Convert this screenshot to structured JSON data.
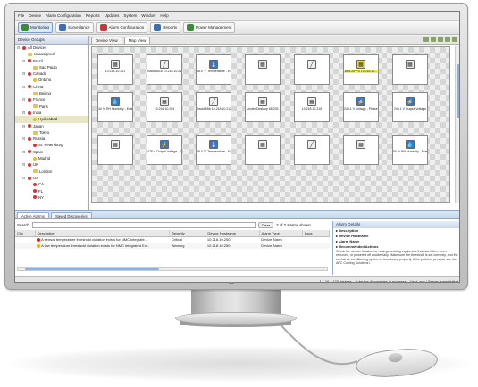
{
  "menubar": [
    "File",
    "Device",
    "Alarm Configuration",
    "Reports",
    "Updates",
    "System",
    "Window",
    "Help"
  ],
  "toolbar": [
    {
      "label": "Monitoring",
      "color": "#3b8a3b",
      "active": true
    },
    {
      "label": "Surveillance",
      "color": "#3b6fb6",
      "active": false
    },
    {
      "label": "Alarm Configuration",
      "color": "#c23b3b",
      "active": false
    },
    {
      "label": "Reports",
      "color": "#3b6fb6",
      "active": false
    },
    {
      "label": "Power Management",
      "color": "#3b8a3b",
      "active": false
    }
  ],
  "left_panel": {
    "title": "Device Groups"
  },
  "tree": [
    {
      "label": "All Devices",
      "level": 0,
      "dot": "r",
      "open": true
    },
    {
      "label": "Unassigned",
      "level": 1,
      "dot": "f"
    },
    {
      "label": "Brazil",
      "level": 1,
      "dot": "r",
      "open": true
    },
    {
      "label": "Sao Paulo",
      "level": 2,
      "dot": "f"
    },
    {
      "label": "Canada",
      "level": 1,
      "dot": "r",
      "open": true
    },
    {
      "label": "Ontario",
      "level": 2,
      "dot": "y"
    },
    {
      "label": "China",
      "level": 1,
      "dot": "r",
      "open": true
    },
    {
      "label": "Beijing",
      "level": 2,
      "dot": "f"
    },
    {
      "label": "France",
      "level": 1,
      "dot": "r",
      "open": true
    },
    {
      "label": "Paris",
      "level": 2,
      "dot": "f"
    },
    {
      "label": "India",
      "level": 1,
      "dot": "r",
      "open": true
    },
    {
      "label": "Hyderabad",
      "level": 2,
      "dot": "y",
      "selected": true
    },
    {
      "label": "Japan",
      "level": 1,
      "dot": "r",
      "open": true
    },
    {
      "label": "Tokyo",
      "level": 2,
      "dot": "f"
    },
    {
      "label": "Russia",
      "level": 1,
      "dot": "r",
      "open": true
    },
    {
      "label": "St. Petersburg",
      "level": 2,
      "dot": "r"
    },
    {
      "label": "Spain",
      "level": 1,
      "dot": "r",
      "open": true
    },
    {
      "label": "Madrid",
      "level": 2,
      "dot": "y"
    },
    {
      "label": "UK",
      "level": 1,
      "dot": "r",
      "open": true
    },
    {
      "label": "London",
      "level": 2,
      "dot": "f"
    },
    {
      "label": "US",
      "level": 1,
      "dot": "r",
      "open": true
    },
    {
      "label": "CA",
      "level": 2,
      "dot": "r"
    },
    {
      "label": "FL",
      "level": 2,
      "dot": "r"
    },
    {
      "label": "NY",
      "level": 2,
      "dot": "r"
    }
  ],
  "tabs": [
    {
      "label": "Device View",
      "active": false
    },
    {
      "label": "Map View",
      "active": true
    }
  ],
  "map_tiles": [
    {
      "caption": "10.218.10.201",
      "glyph": "▦",
      "tone": "grey"
    },
    {
      "caption": "Rack 8516 10.218.10.211",
      "glyph": "╱",
      "tone": "grey"
    },
    {
      "caption": "68.0 °F Temperature - Extern",
      "glyph": "🌡",
      "tone": "blue"
    },
    {
      "caption": "",
      "glyph": "▦",
      "tone": "grey"
    },
    {
      "caption": "",
      "glyph": "╱",
      "tone": "grey"
    },
    {
      "caption": "AP8-APPS 10.218.10...",
      "glyph": "▦",
      "tone": "yellow",
      "highlight": true
    },
    {
      "caption": "",
      "glyph": "▦",
      "tone": "grey"
    },
    {
      "caption": "40 % RH Humidity - External",
      "glyph": "💧",
      "tone": "blue"
    },
    {
      "caption": "10.216.10.204",
      "glyph": "▦",
      "tone": "grey"
    },
    {
      "caption": "Rack8656 10.218.10.212",
      "glyph": "╱",
      "tone": "grey"
    },
    {
      "caption": "Under Desktop 68.033",
      "glyph": "▦",
      "tone": "grey"
    },
    {
      "caption": "10.218.10.215",
      "glyph": "▦",
      "tone": "grey"
    },
    {
      "caption": "245.1 V Voltage - Phase 1",
      "glyph": "⚡",
      "tone": "blue"
    },
    {
      "caption": "245.1 V Output Voltage",
      "glyph": "⚡",
      "tone": "blue"
    },
    {
      "caption": "",
      "glyph": "▦",
      "tone": "grey"
    },
    {
      "caption": "478 V Output Voltage - Phas",
      "glyph": "⚡",
      "tone": "blue"
    },
    {
      "caption": "68.0 °F Temperature - Extern",
      "glyph": "🌡",
      "tone": "blue"
    },
    {
      "caption": "",
      "glyph": "▦",
      "tone": "grey"
    },
    {
      "caption": "",
      "glyph": "╱",
      "tone": "grey"
    },
    {
      "caption": "",
      "glyph": "▦",
      "tone": "grey"
    },
    {
      "caption": "50 % RH Humidity - External",
      "glyph": "💧",
      "tone": "blue"
    }
  ],
  "lower": {
    "tabs": [
      {
        "label": "Active Alarms",
        "active": true
      },
      {
        "label": "Saved Discoveries",
        "active": false
      }
    ],
    "search_label": "Search",
    "search_placeholder": "",
    "clear_label": "Clear",
    "shown_text": "2 of 2 alarms shown",
    "columns": [
      "Clip",
      "Description",
      "Severity",
      "Device Hostname",
      "Alarm Type",
      "Loca"
    ],
    "rows": [
      {
        "clip": "",
        "description": "A sensor temperature threshold violation exists for NMC integrate...",
        "severity": "Critical",
        "sev": "c",
        "hostname": "10.218.10.250",
        "type": "Device Alarm",
        "loc": ""
      },
      {
        "clip": "",
        "description": "A low temperature threshold violation exists for NMC integrated En...",
        "severity": "Warning",
        "sev": "w",
        "hostname": "10.218.10.250",
        "type": "Device Alarm",
        "loc": ""
      }
    ]
  },
  "details": {
    "title": "Alarm Details",
    "items": [
      "Description",
      "Device Hostname",
      "Alarm Name",
      "Recommended Actions"
    ],
    "text": "Check the sensor location for heat-generating equipment that has fallen, been removed, or powered off accidentally. Make sure the threshold is set correctly, and the central air conditioning system is functioning properly. If the problem persists, see the APC Cooling Solutions I"
  },
  "status": [
    "1",
    "10",
    "170 devices",
    "0 device discoveries in progress",
    "User: apc | Server: swadsbfkat"
  ]
}
